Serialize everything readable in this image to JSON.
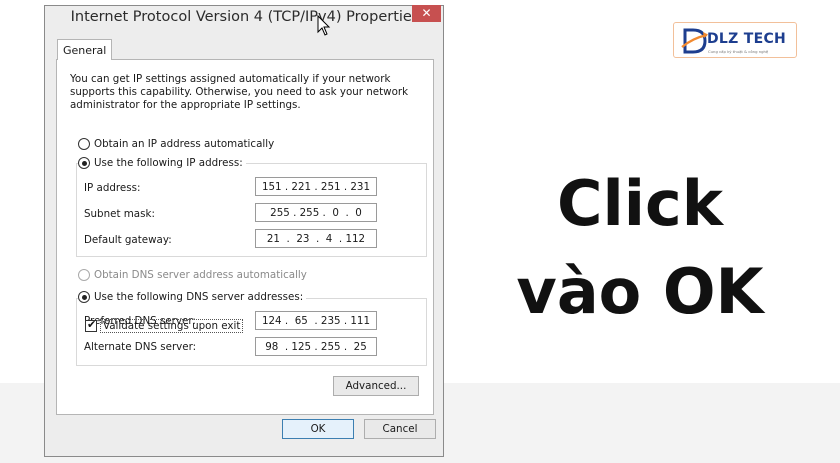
{
  "dialog": {
    "title": "Internet Protocol Version 4 (TCP/IPv4) Properties",
    "close_label": "✕",
    "tab_label": "General",
    "intro": "You can get IP settings assigned automatically if your network supports this capability. Otherwise, you need to ask your network administrator for the appropriate IP settings.",
    "ip_auto_label": "Obtain an IP address automatically",
    "ip_manual_label": "Use the following IP address:",
    "ip_address_label": "IP address:",
    "ip_address_value": "151 . 221 . 251 . 231",
    "subnet_label": "Subnet mask:",
    "subnet_value": "255 . 255 .  0  .  0",
    "gateway_label": "Default gateway:",
    "gateway_value": "21  .  23  .  4  . 112",
    "dns_auto_label": "Obtain DNS server address automatically",
    "dns_manual_label": "Use the following DNS server addresses:",
    "preferred_dns_label": "Preferred DNS server:",
    "preferred_dns_value": "124 .  65  . 235 . 111",
    "alternate_dns_label": "Alternate DNS server:",
    "alternate_dns_value": "98  . 125 . 255 .  25",
    "validate_label": "Validate settings upon exit",
    "validate_checked": true,
    "advanced_label": "Advanced...",
    "ok_label": "OK",
    "cancel_label": "Cancel"
  },
  "logo": {
    "text": "DLZ TECH",
    "tagline": "Cung cấp kỹ thuật & công nghệ"
  },
  "caption": {
    "line1": "Click",
    "line2": "vào OK"
  },
  "colors": {
    "close_button": "#c75050",
    "logo_blue": "#1d3e8f",
    "logo_border": "#f2c09a",
    "default_button_border": "#3c7fb1"
  }
}
